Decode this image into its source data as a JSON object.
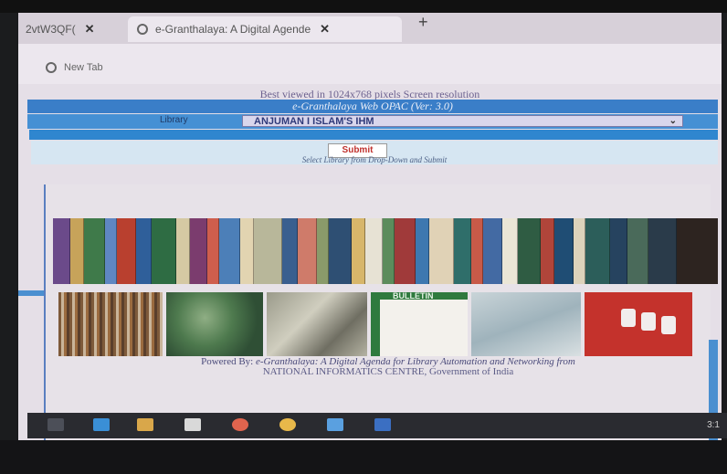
{
  "browser": {
    "tabs": [
      {
        "label": "2vtW3QF(",
        "close": "✕"
      },
      {
        "label": "e-Granthalaya: A Digital Agende",
        "close": "✕"
      }
    ],
    "new_tab_plus": "+",
    "new_tab_link": "New Tab"
  },
  "page": {
    "best_viewed": "Best viewed in 1024x768 pixels Screen resolution",
    "opac_title": "e-Granthalaya Web OPAC (Ver: 3.0)",
    "library_label": "Library",
    "library_selected": "ANJUMAN I ISLAM'S IHM",
    "submit_label": "Submit",
    "select_hint": "Select Library from Drop-Down and Submit",
    "bulletin_label": "BULLETIN",
    "powered_by": "Powered By: ",
    "powered_brand": "e-Granthalaya: A Digital Agenda for Library Automation and Networking from",
    "nic_line": "NATIONAL INFORMATICS CENTRE, Government of India"
  },
  "taskbar": {
    "tray_time": "3:1"
  },
  "colors": {
    "band_blue": "#3a7ec8",
    "submit_red": "#c0322e"
  }
}
